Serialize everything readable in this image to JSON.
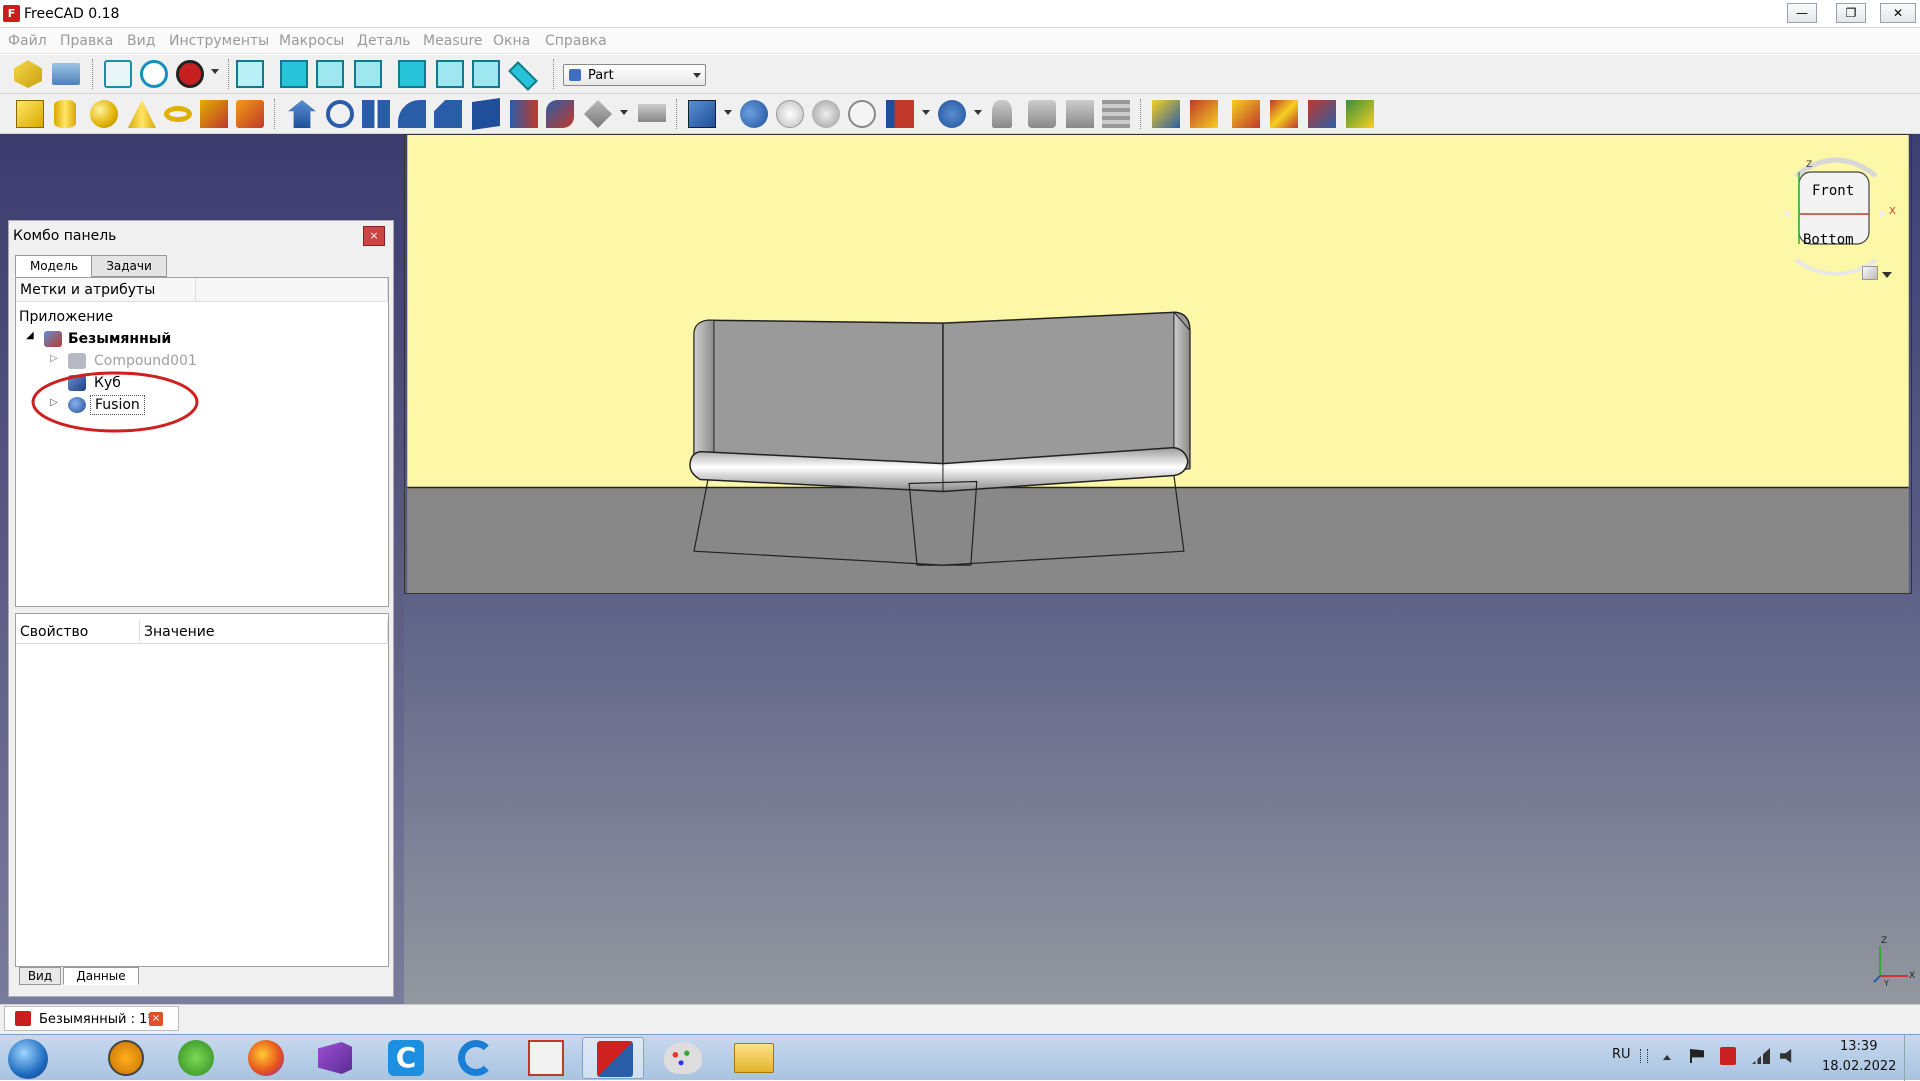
{
  "window": {
    "title": "FreeCAD 0.18",
    "buttons": [
      "—",
      "❐",
      "✕"
    ]
  },
  "menu": [
    "Файл",
    "Правка",
    "Вид",
    "Инструменты",
    "Макросы",
    "Деталь",
    "Measure",
    "Окна",
    "Справка"
  ],
  "workbench": {
    "selected": "Part"
  },
  "combo": {
    "title": "Комбо панель",
    "close": "×",
    "tabs": [
      "Модель",
      "Задачи"
    ],
    "tree_header": "Метки и атрибуты",
    "application_label": "Приложение",
    "document": "Безымянный",
    "items": [
      {
        "label": "Compound001",
        "expander": "▷",
        "dimmed": true
      },
      {
        "label": "Куб",
        "expander": ""
      },
      {
        "label": "Fusion",
        "expander": "▷"
      }
    ],
    "property_headers": [
      "Свойство",
      "Значение"
    ],
    "bottom_tabs": [
      "Вид",
      "Данные"
    ]
  },
  "navcube": {
    "front": "Front",
    "bottom": "Bottom",
    "z": "Z",
    "x": "X"
  },
  "axis": {
    "z": "Z",
    "x": "X",
    "y": "Y"
  },
  "doc_tab": {
    "label": "Безымянный : 1*"
  },
  "tray": {
    "lang": "RU",
    "time": "13:39",
    "date": "18.02.2022"
  },
  "colors": {
    "highlight_circle": "#d01f1f",
    "sky": "#fdf8a8",
    "ground": "#888888"
  }
}
